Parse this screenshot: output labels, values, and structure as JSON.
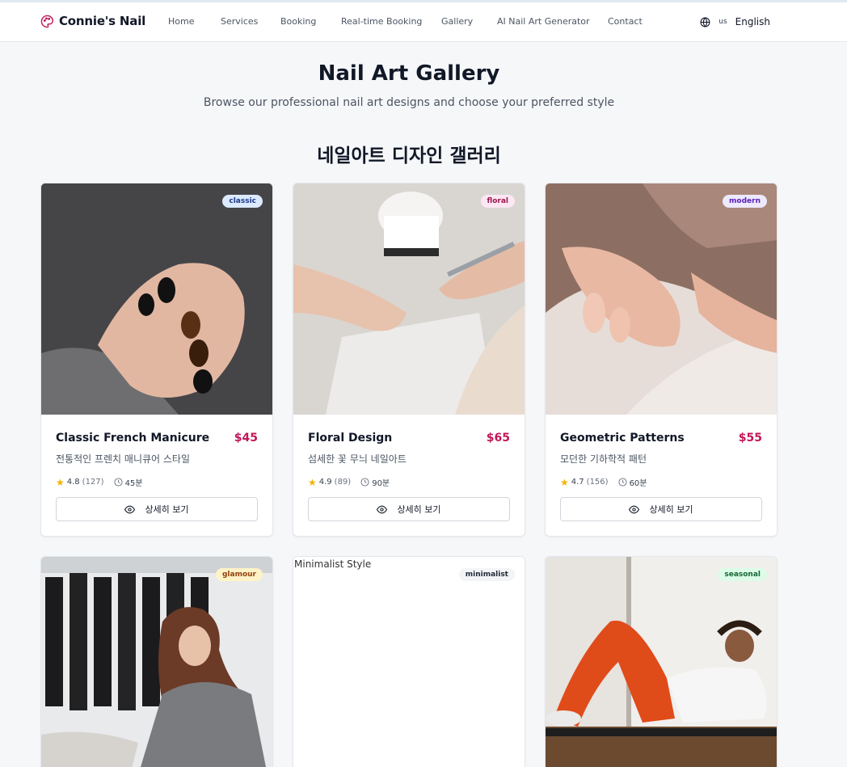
{
  "brand": {
    "name": "Connie's Nail",
    "icon": "palette-icon"
  },
  "nav": [
    "Home",
    "Services",
    "Booking",
    "Real-time Booking",
    "Gallery",
    "AI Nail Art Generator",
    "Contact"
  ],
  "language": {
    "icon": "globe-icon",
    "flag": "us",
    "label": "English"
  },
  "hero": {
    "title": "Nail Art Gallery",
    "subtitle": "Browse our professional nail art designs and choose your preferred style"
  },
  "gallery": {
    "title": "네일아트 디자인 갤러리",
    "cards": [
      {
        "badge": "classic",
        "name": "Classic French Manicure",
        "price": "$45",
        "desc": "전통적인 프렌치 매니큐어 스타일",
        "rating": "4.8",
        "count": "(127)",
        "duration": "45분",
        "button": "상세히 보기"
      },
      {
        "badge": "floral",
        "name": "Floral Design",
        "price": "$65",
        "desc": "섬세한 꽃 무늬 네일아트",
        "rating": "4.9",
        "count": "(89)",
        "duration": "90분",
        "button": "상세히 보기"
      },
      {
        "badge": "modern",
        "name": "Geometric Patterns",
        "price": "$55",
        "desc": "모던한 기하학적 패턴",
        "rating": "4.7",
        "count": "(156)",
        "duration": "60분",
        "button": "상세히 보기"
      },
      {
        "badge": "glamour"
      },
      {
        "badge": "minimalist",
        "alt": "Minimalist Style"
      },
      {
        "badge": "seasonal"
      }
    ]
  },
  "colors": {
    "accent": "#c0185a",
    "star": "#f5b301"
  }
}
